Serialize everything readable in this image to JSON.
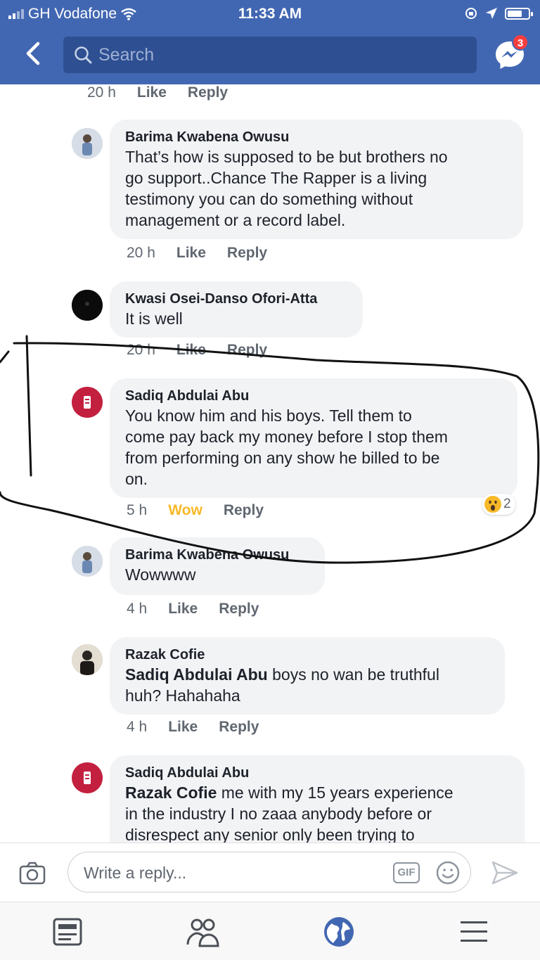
{
  "status_bar": {
    "carrier": "GH Vodafone",
    "time": "11:33 AM"
  },
  "header": {
    "search_placeholder": "Search",
    "messenger_badge": "3"
  },
  "comments": [
    {
      "time": "20 h",
      "like": "Like",
      "reply": "Reply"
    },
    {
      "author": "Barima Kwabena Owusu",
      "lines": [
        "That’s how is supposed to be but brothers no",
        "go support..Chance The Rapper is a living",
        "testimony you can do something without",
        "management or a record label."
      ],
      "time": "20 h",
      "like": "Like",
      "reply": "Reply"
    },
    {
      "author": "Kwasi Osei-Danso Ofori-Atta",
      "lines": [
        "It is well"
      ],
      "time": "20 h",
      "like": "Like",
      "reply": "Reply"
    },
    {
      "author": "Sadiq Abdulai Abu",
      "lines": [
        "You know him and his boys. Tell them to",
        "come pay back my money before I stop them",
        "from performing on any show he billed to be",
        "on."
      ],
      "time": "5 h",
      "like": "Wow",
      "reply": "Reply",
      "reaction_count": "2"
    },
    {
      "author": "Barima Kwabena Owusu",
      "lines": [
        "Wowwww"
      ],
      "time": "4 h",
      "like": "Like",
      "reply": "Reply"
    },
    {
      "author": "Razak Cofie",
      "tag": "Sadiq Abdulai Abu",
      "first_line_rest": " boys no wan be truthful",
      "lines": [
        "huh? Hahahaha"
      ],
      "time": "4 h",
      "like": "Like",
      "reply": "Reply"
    },
    {
      "author": "Sadiq Abdulai Abu",
      "tag": "Razak Cofie",
      "first_line_rest": " me with my 15 years experience",
      "lines": [
        "in the industry I no zaaa anybody before or",
        "disrespect any senior only been trying to"
      ]
    }
  ],
  "composer": {
    "placeholder": "Write a reply...",
    "gif_label": "GIF"
  },
  "colors": {
    "brand": "#4267b2",
    "wow": "#f7b928",
    "badge": "#fa3e3e"
  },
  "icons": {
    "tabs": [
      "news-feed-icon",
      "friends-icon",
      "globe-icon",
      "menu-icon"
    ]
  }
}
